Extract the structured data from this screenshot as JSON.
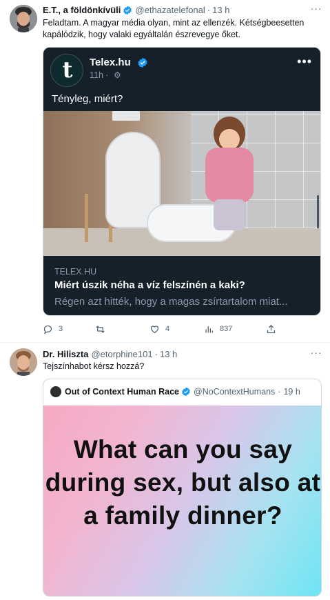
{
  "tweets": [
    {
      "name": "E.T., a földönkívüli",
      "handle": "@ethazatelefonal",
      "separator": "·",
      "time": "13 h",
      "text": "Feladtam. A magyar média olyan, mint az ellenzék. Kétségbeesetten kapálódzik, hogy valaki egyáltalán észrevegye őket.",
      "embedded": {
        "name": "Telex.hu",
        "avatar_letter": "t",
        "time": "11h",
        "separator": "·",
        "text": "Tényleg, miért?",
        "link_domain": "TELEX.HU",
        "link_title": "Miért úszik néha a víz felszínén a kaki?",
        "link_desc": "Régen azt hitték, hogy a magas zsírtartalom miat..."
      },
      "actions": {
        "reply_count": "3",
        "retweet_count": "",
        "like_count": "4",
        "views_count": "837"
      }
    },
    {
      "name": "Dr. Hiliszta",
      "handle": "@etorphine101",
      "separator": "·",
      "time": "13 h",
      "text": "Tejszínhabot kérsz hozzá?",
      "quoted": {
        "name": "Out of Context Human Race",
        "handle": "@NoContextHumans",
        "separator": "·",
        "time": "19 h",
        "image_text": "What can you say during sex, but also at a family dinner?"
      }
    }
  ],
  "colors": {
    "verified": "#1d9bf0",
    "secondary_text": "#536471",
    "dark_card_bg": "#15202b"
  }
}
